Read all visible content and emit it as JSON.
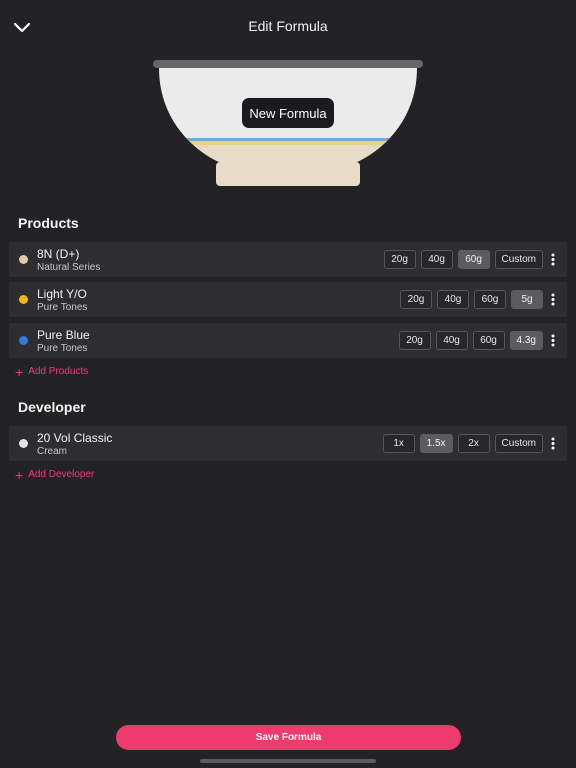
{
  "header": {
    "title": "Edit Formula",
    "close_icon": "chevron-down-icon"
  },
  "bowl": {
    "formula_name": "New Formula",
    "colors": {
      "rim": "#676769",
      "body": "#ebebeb",
      "blue_band": "#7aa6d6",
      "yellow_band": "#ecd27c",
      "cream": "#e7dcc7"
    }
  },
  "products": {
    "section_title": "Products",
    "items": [
      {
        "name": "8N (D+)",
        "series": "Natural Series",
        "color": "#e0c9a6",
        "options": [
          "20g",
          "40g",
          "60g",
          "Custom"
        ],
        "selected": 2
      },
      {
        "name": "Light Y/O",
        "series": "Pure Tones",
        "color": "#f4b41a",
        "options": [
          "20g",
          "40g",
          "60g",
          "5g"
        ],
        "selected": 3
      },
      {
        "name": "Pure Blue",
        "series": "Pure Tones",
        "color": "#2f7de1",
        "options": [
          "20g",
          "40g",
          "60g",
          "4.3g"
        ],
        "selected": 3
      }
    ],
    "add_label": "Add Products"
  },
  "developer": {
    "section_title": "Developer",
    "items": [
      {
        "name": "20 Vol Classic",
        "series": "Cream",
        "color": "#e4e4e4",
        "options": [
          "1x",
          "1.5x",
          "2x",
          "Custom"
        ],
        "selected": 1
      }
    ],
    "add_label": "Add Developer"
  },
  "footer": {
    "save_label": "Save Formula"
  },
  "theme": {
    "background": "#232326",
    "row": "#2e2e31",
    "accent": "#ec3b6c"
  }
}
